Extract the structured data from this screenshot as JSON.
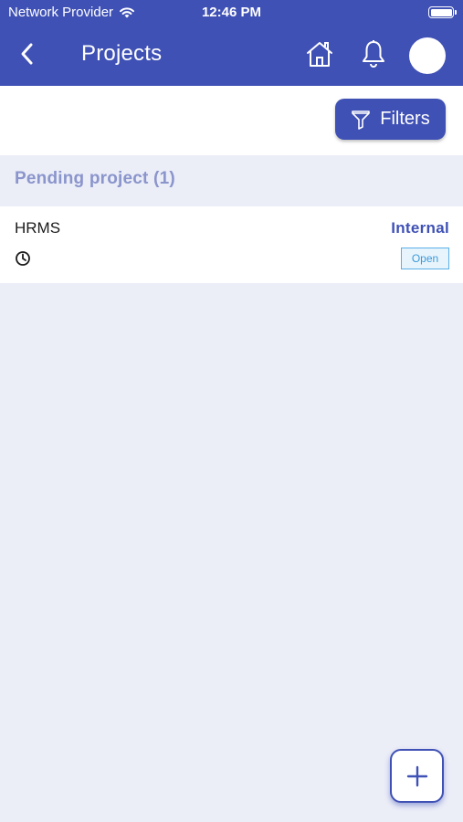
{
  "status_bar": {
    "carrier": "Network Provider",
    "time": "12:46 PM",
    "wifi_icon": "wifi-icon",
    "battery_icon": "battery-icon"
  },
  "navbar": {
    "title": "Projects",
    "back_icon": "chevron-left-icon",
    "home_icon": "home-icon",
    "bell_icon": "bell-icon"
  },
  "toolbar": {
    "filters_label": "Filters",
    "filter_icon": "funnel-icon"
  },
  "section": {
    "title": "Pending project (1)"
  },
  "projects": [
    {
      "name": "HRMS",
      "type": "Internal",
      "status": "Open",
      "clock_icon": "clock-icon"
    }
  ],
  "fab": {
    "icon": "plus-icon"
  },
  "colors": {
    "primary": "#3f51b5",
    "background": "#ebedf7",
    "section_text": "#8a95cc",
    "badge_border": "#5ab0e8"
  }
}
